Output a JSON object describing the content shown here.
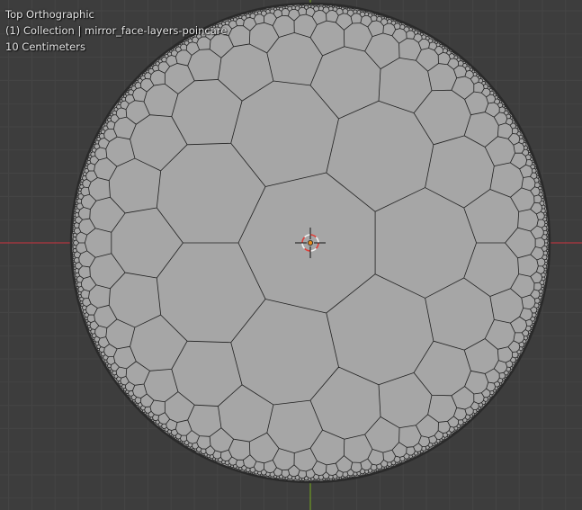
{
  "viewport": {
    "view_name": "Top Orthographic",
    "collection_line": "(1) Collection | mirror_face-layers-poincare",
    "scale_line": "10 Centimeters"
  },
  "colors": {
    "background": "#3d3d3d",
    "grid_minor": "#454545",
    "grid_major": "#4a4a4a",
    "x_axis": "#b2363f",
    "y_axis": "#6e9a23",
    "disk_fill": "#a6a6a6",
    "edge": "#202020",
    "rim": "#2a2a2a",
    "origin_dot": "#e58b1d",
    "cursor_red": "#e0403a",
    "cursor_white": "#f0f0f0"
  },
  "scene": {
    "object": "mirror_face-layers-poincare",
    "tiling": "hyperbolic {7,3} heptagonal tiling in Poincaré disk",
    "icons": [
      "3d-cursor-icon",
      "object-origin-icon"
    ]
  }
}
